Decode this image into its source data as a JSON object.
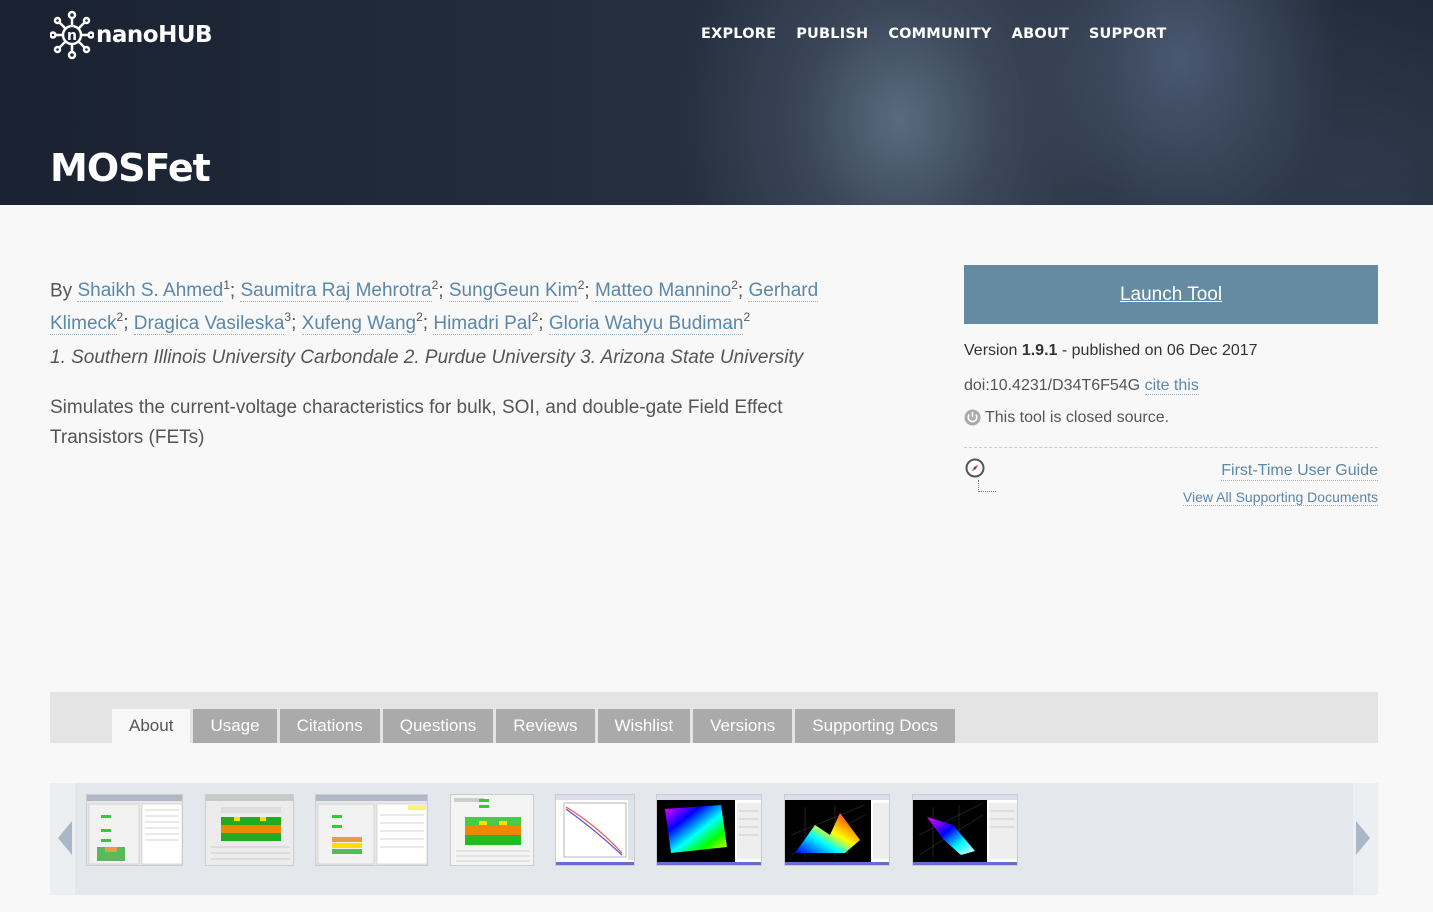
{
  "header": {
    "logo_text": "nanoHUB",
    "nav": [
      "EXPLORE",
      "PUBLISH",
      "COMMUNITY",
      "ABOUT",
      "SUPPORT"
    ],
    "title": "MOSFet"
  },
  "authors": {
    "prefix": "By",
    "list": [
      {
        "name": "Shaikh S. Ahmed",
        "aff": "1"
      },
      {
        "name": "Saumitra Raj Mehrotra",
        "aff": "2"
      },
      {
        "name": "SungGeun Kim",
        "aff": "2"
      },
      {
        "name": "Matteo Mannino",
        "aff": "2"
      },
      {
        "name": "Gerhard Klimeck",
        "aff": "2"
      },
      {
        "name": "Dragica Vasileska",
        "aff": "3"
      },
      {
        "name": "Xufeng Wang",
        "aff": "2"
      },
      {
        "name": "Himadri Pal",
        "aff": "2"
      },
      {
        "name": "Gloria Wahyu Budiman",
        "aff": "2"
      }
    ],
    "affiliations": "1. Southern Illinois University Carbondale 2. Purdue University 3. Arizona State University"
  },
  "description": "Simulates the current-voltage characteristics for bulk, SOI, and double-gate Field Effect Transistors (FETs)",
  "sidebar": {
    "launch_label": "Launch Tool",
    "version_prefix": "Version",
    "version": "1.9.1",
    "published": "- published on 06 Dec 2017",
    "doi": "doi:10.4231/D34T6F54G",
    "cite_label": "cite this",
    "closed_source": "This tool is closed source.",
    "guide_label": "First-Time User Guide",
    "all_docs_label": "View All Supporting Documents"
  },
  "tabs": [
    "About",
    "Usage",
    "Citations",
    "Questions",
    "Reviews",
    "Wishlist",
    "Versions",
    "Supporting Docs"
  ],
  "active_tab": "About",
  "colors": {
    "accent": "#658ba3",
    "link": "#5b87a8",
    "tab_inactive": "#aaaaaa"
  },
  "screenshots": [
    "screenshot-1",
    "screenshot-2",
    "screenshot-3",
    "screenshot-4",
    "screenshot-5",
    "screenshot-6",
    "screenshot-7",
    "screenshot-8"
  ]
}
